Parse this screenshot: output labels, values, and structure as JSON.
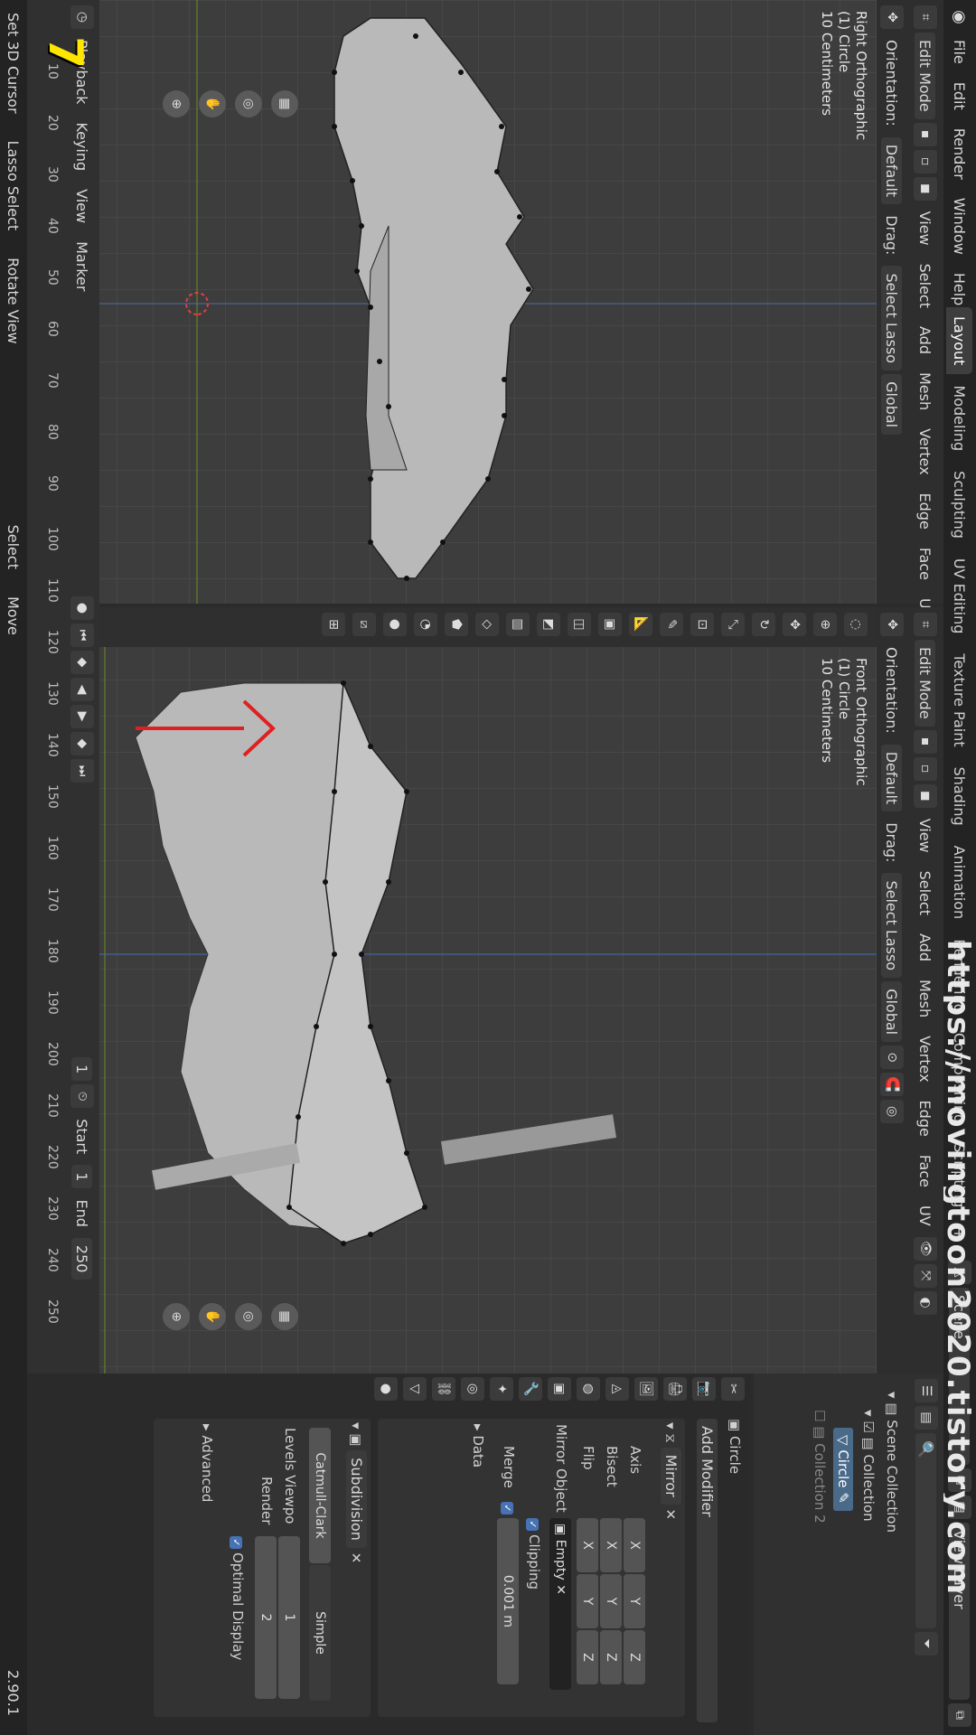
{
  "watermark": "https://movingtoon2020.tistory.com",
  "overlay_number": "7",
  "menu": {
    "file": "File",
    "edit": "Edit",
    "render": "Render",
    "window": "Window",
    "help": "Help"
  },
  "workspace_tabs": [
    "Layout",
    "Modeling",
    "Sculpting",
    "UV Editing",
    "Texture Paint",
    "Shading",
    "Animation",
    "Rendering",
    "Compositing",
    "Scripting"
  ],
  "add_tab": "+",
  "scene": "Scene",
  "view_layer": "View Layer",
  "viewport_header": {
    "mode": "Edit Mode",
    "orientation_label": "Orientation:",
    "orientation_value": "Default",
    "drag_label": "Drag:",
    "drag_value": "Select Lasso",
    "transform_value": "Global",
    "menus": [
      "View",
      "Select",
      "Add",
      "Mesh",
      "Vertex",
      "Edge",
      "Face",
      "UV"
    ]
  },
  "left_viewport": {
    "view_name": "Right Orthographic",
    "object": "(1) Circle",
    "scale": "10 Centimeters"
  },
  "right_viewport": {
    "view_name": "Front Orthographic",
    "object": "(1) Circle",
    "scale": "10 Centimeters"
  },
  "timeline": {
    "playback": "Playback",
    "keying": "Keying",
    "view": "View",
    "marker": "Marker",
    "ticks": [
      "10",
      "20",
      "30",
      "40",
      "50",
      "60",
      "70",
      "80",
      "90",
      "100",
      "110",
      "120",
      "130",
      "140",
      "150",
      "160",
      "170",
      "180",
      "190",
      "200",
      "210",
      "220",
      "230",
      "240",
      "250"
    ],
    "current_frame": "1",
    "start_label": "Start",
    "start_value": "1",
    "end_label": "End",
    "end_value": "250"
  },
  "statusbar": {
    "set_cursor": "Set 3D Cursor",
    "lasso": "Lasso Select",
    "rotate": "Rotate View",
    "select": "Select",
    "move": "Move",
    "version": "2.90.1"
  },
  "outliner": {
    "scene_collection": "Scene Collection",
    "collection": "Collection",
    "circle": "Circle",
    "collection2": "Collection 2"
  },
  "properties": {
    "object_name": "Circle",
    "add_modifier": "Add Modifier",
    "mirror": {
      "name": "Mirror",
      "axis_label": "Axis",
      "bisect_label": "Bisect",
      "flip_label": "Flip",
      "x": "X",
      "y": "Y",
      "z": "Z",
      "mirror_object_label": "Mirror Object",
      "mirror_object_value": "Empty",
      "clipping": "Clipping",
      "merge_label": "Merge",
      "merge_value": "0.001 m",
      "data_label": "Data"
    },
    "subdivision": {
      "name": "Subdivision",
      "catmull": "Catmull-Clark",
      "simple": "Simple",
      "levels_label": "Levels Viewpo",
      "levels_value": "1",
      "render_label": "Render",
      "render_value": "2",
      "optimal": "Optimal Display",
      "advanced": "Advanced"
    }
  },
  "colors": {
    "accent": "#4772b3",
    "annotation_arrow": "#e02020",
    "mesh": "#b9b9b9",
    "vertex": "#111111"
  }
}
